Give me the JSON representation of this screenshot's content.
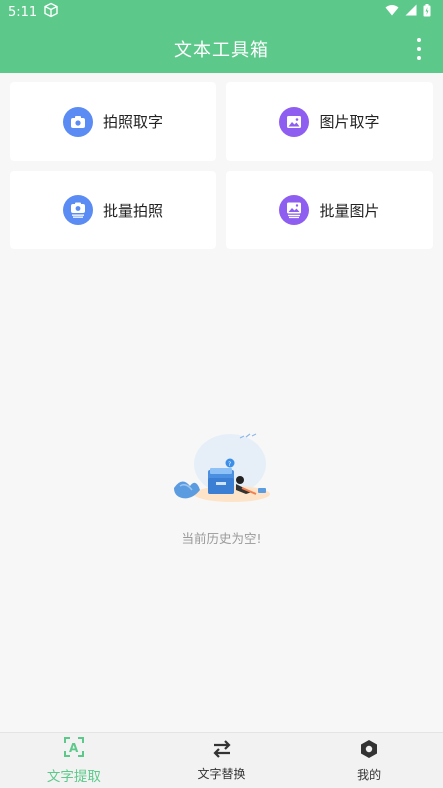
{
  "status_bar": {
    "time": "5:11"
  },
  "app_bar": {
    "title": "文本工具箱",
    "more_icon": "more-vert-icon"
  },
  "cards": [
    {
      "label": "拍照取字",
      "icon": "camera-icon",
      "color": "#5b8cf3"
    },
    {
      "label": "图片取字",
      "icon": "image-icon",
      "color": "#8e5ef0"
    },
    {
      "label": "批量拍照",
      "icon": "batch-camera-icon",
      "color": "#5b8cf3"
    },
    {
      "label": "批量图片",
      "icon": "batch-image-icon",
      "color": "#8e5ef0"
    }
  ],
  "empty_state": {
    "text": "当前历史为空!"
  },
  "bottom_nav": [
    {
      "label": "文字提取",
      "icon": "text-scan-icon",
      "active": true
    },
    {
      "label": "文字替换",
      "icon": "swap-icon",
      "active": false
    },
    {
      "label": "我的",
      "icon": "hexagon-settings-icon",
      "active": false
    }
  ],
  "colors": {
    "primary": "#5cc98b",
    "blue": "#5b8cf3",
    "purple": "#8e5ef0"
  }
}
